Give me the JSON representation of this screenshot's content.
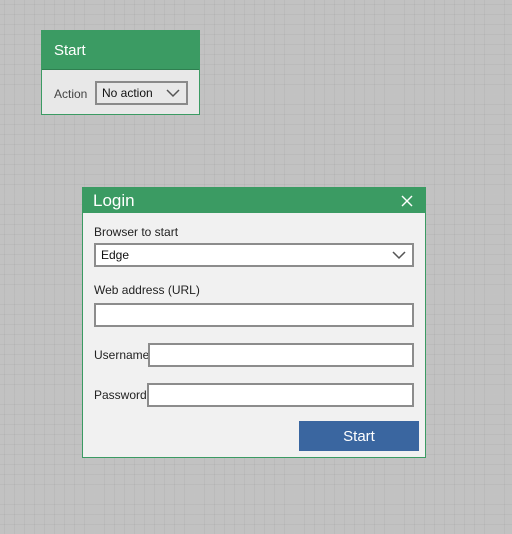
{
  "start_node": {
    "title": "Start",
    "action_label": "Action",
    "action_value": "No action",
    "chevron_icon": "chevron-down-icon"
  },
  "login_dialog": {
    "title": "Login",
    "close_icon": "close-icon",
    "browser_label": "Browser to start",
    "browser_value": "Edge",
    "url_label": "Web address (URL)",
    "url_value": "",
    "username_label": "Username",
    "username_value": "",
    "password_label": "Password",
    "password_value": "",
    "start_button_label": "Start"
  },
  "colors": {
    "accent_green": "#3b9b63",
    "button_blue": "#3a66a0",
    "canvas_gray": "#c2c2c2",
    "panel_gray": "#f1f1f1"
  }
}
